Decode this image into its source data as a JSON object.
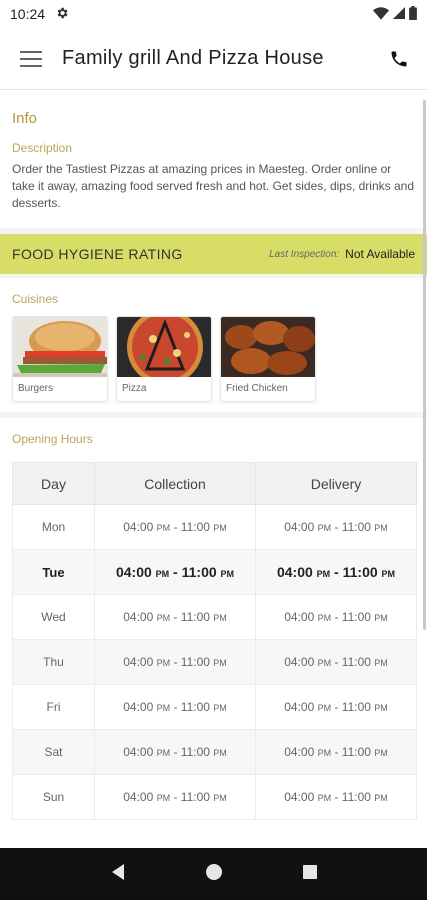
{
  "status": {
    "time": "10:24"
  },
  "header": {
    "title": "Family grill And Pizza House"
  },
  "info": {
    "title": "Info",
    "description_label": "Description",
    "description": "Order the Tastiest Pizzas at amazing prices in Maesteg. Order online or take it away, amazing food served fresh and hot. Get sides, dips, drinks and desserts."
  },
  "hygiene": {
    "title": "FOOD HYGIENE RATING",
    "inspection_label": "Last Inspection:",
    "inspection_value": "Not Available"
  },
  "cuisines": {
    "label": "Cuisines",
    "items": [
      {
        "name": "Burgers"
      },
      {
        "name": "Pizza"
      },
      {
        "name": "Fried Chicken"
      }
    ]
  },
  "hours": {
    "label": "Opening Hours",
    "headers": {
      "day": "Day",
      "collection": "Collection",
      "delivery": "Delivery"
    },
    "rows": [
      {
        "day": "Mon",
        "c_start": "04:00",
        "c_end": "11:00",
        "d_start": "04:00",
        "d_end": "11:00"
      },
      {
        "day": "Tue",
        "c_start": "04:00",
        "c_end": "11:00",
        "d_start": "04:00",
        "d_end": "11:00"
      },
      {
        "day": "Wed",
        "c_start": "04:00",
        "c_end": "11:00",
        "d_start": "04:00",
        "d_end": "11:00"
      },
      {
        "day": "Thu",
        "c_start": "04:00",
        "c_end": "11:00",
        "d_start": "04:00",
        "d_end": "11:00"
      },
      {
        "day": "Fri",
        "c_start": "04:00",
        "c_end": "11:00",
        "d_start": "04:00",
        "d_end": "11:00"
      },
      {
        "day": "Sat",
        "c_start": "04:00",
        "c_end": "11:00",
        "d_start": "04:00",
        "d_end": "11:00"
      },
      {
        "day": "Sun",
        "c_start": "04:00",
        "c_end": "11:00",
        "d_start": "04:00",
        "d_end": "11:00"
      }
    ],
    "pm": "PM"
  },
  "colors": {
    "accent_gold": "#b09a3a",
    "hygiene_bar": "#d8dd67",
    "nav_bar": "#111111"
  },
  "icons": {
    "status": [
      "gear-icon",
      "wifi-icon",
      "signal-icon",
      "battery-icon"
    ],
    "header": [
      "menu-icon",
      "phone-icon"
    ],
    "nav": [
      "back-icon",
      "home-icon",
      "recents-icon"
    ]
  }
}
